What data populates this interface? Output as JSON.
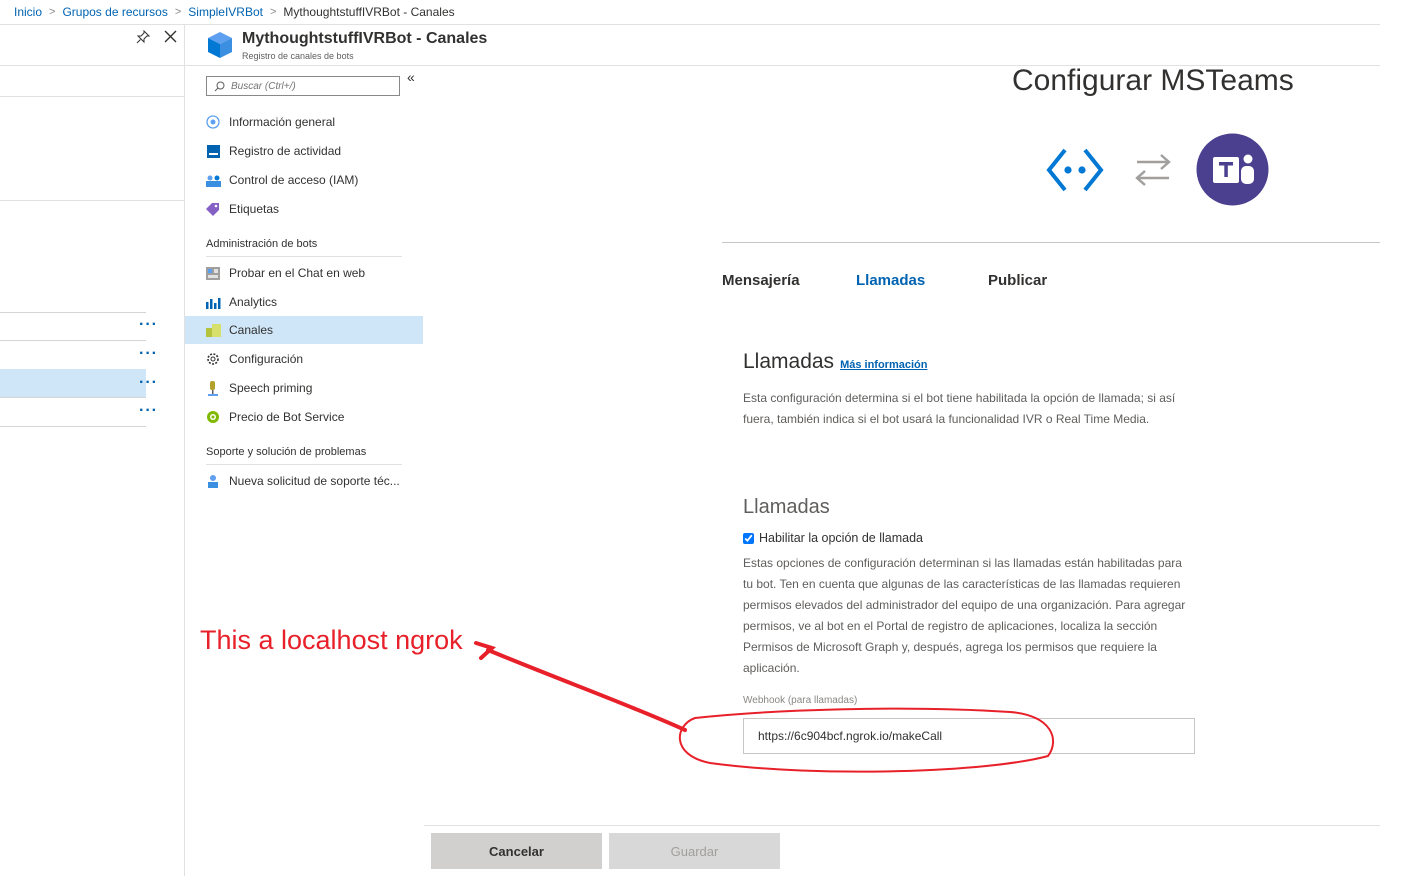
{
  "breadcrumb": {
    "items": [
      "Inicio",
      "Grupos de recursos",
      "SimpleIVRBot"
    ],
    "current": "MythoughtstuffIVRBot - Canales"
  },
  "blade": {
    "title": "MythoughtstuffIVRBot - Canales",
    "subtitle": "Registro de canales de bots"
  },
  "menu": {
    "search_placeholder": "Buscar (Ctrl+/)",
    "collapse_glyph": "«",
    "items": [
      {
        "label": "Información general",
        "icon": "overview-icon"
      },
      {
        "label": "Registro de actividad",
        "icon": "activity-log-icon"
      },
      {
        "label": "Control de acceso (IAM)",
        "icon": "iam-icon"
      },
      {
        "label": "Etiquetas",
        "icon": "tag-icon"
      }
    ],
    "section_bots": "Administración de bots",
    "bot_items": [
      {
        "label": "Probar en el Chat en web",
        "icon": "webchat-icon"
      },
      {
        "label": "Analytics",
        "icon": "analytics-icon"
      },
      {
        "label": "Canales",
        "icon": "channels-icon"
      },
      {
        "label": "Configuración",
        "icon": "settings-icon"
      },
      {
        "label": "Speech priming",
        "icon": "speech-icon"
      },
      {
        "label": "Precio de Bot Service",
        "icon": "pricing-icon"
      }
    ],
    "section_support": "Soporte y solución de problemas",
    "support_items": [
      {
        "label": "Nueva solicitud de soporte téc...",
        "icon": "support-icon"
      }
    ]
  },
  "content": {
    "config_title": "Configurar MSTeams",
    "tabs": [
      "Mensajería",
      "Llamadas",
      "Publicar"
    ],
    "active_tab": "Llamadas",
    "section_title": "Llamadas",
    "more_info": "Más información",
    "description": "Esta configuración determina si el bot tiene habilitada la opción de llamada; si así fuera, también indica si el bot usará la funcionalidad IVR o Real Time Media.",
    "sub_title": "Llamadas",
    "checkbox_label": "Habilitar la opción de llamada",
    "checkbox_checked": true,
    "checkbox_description": "Estas opciones de configuración determinan si las llamadas están habilitadas para tu bot. Ten en cuenta que algunas de las características de las llamadas requieren permisos elevados del administrador del equipo de una organización. Para agregar permisos, ve al bot en el Portal de registro de aplicaciones, localiza la sección Permisos de Microsoft Graph y, después, agrega los permisos que requiere la aplicación.",
    "webhook_label": "Webhook (para llamadas)",
    "webhook_value": "https://6c904bcf.ngrok.io/makeCall"
  },
  "footer": {
    "cancel_label": "Cancelar",
    "save_label": "Guardar"
  },
  "annotation": {
    "text": "This a localhost ngrok"
  },
  "colors": {
    "accent": "#0063b1",
    "teams": "#4b3f8f",
    "selected": "#cfe6f8",
    "annotation": "#e8202a"
  }
}
